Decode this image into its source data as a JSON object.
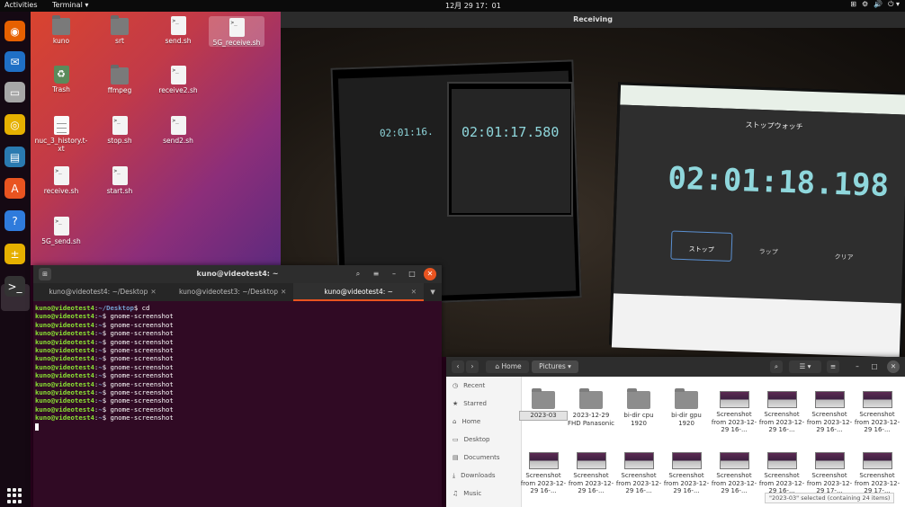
{
  "topbar": {
    "activities": "Activities",
    "app_menu": "Terminal ▾",
    "clock": "12月 29 17：01",
    "tray": [
      "⊞",
      "⚙",
      "🔊",
      "⏻ ▾"
    ]
  },
  "dock": {
    "items": [
      {
        "name": "firefox-icon",
        "glyph": "◉",
        "color": "#e66000"
      },
      {
        "name": "thunderbird-icon",
        "glyph": "✉",
        "color": "#1f6fc5"
      },
      {
        "name": "files-icon",
        "glyph": "▭",
        "color": "#a7a7a7"
      },
      {
        "name": "rhythmbox-icon",
        "glyph": "◎",
        "color": "#e6b000"
      },
      {
        "name": "writer-icon",
        "glyph": "▤",
        "color": "#2a7ab0"
      },
      {
        "name": "software-icon",
        "glyph": "A",
        "color": "#e95420"
      },
      {
        "name": "help-icon",
        "glyph": "?",
        "color": "#2f7bdc"
      },
      {
        "name": "calculator-icon",
        "glyph": "±",
        "color": "#e6b000"
      },
      {
        "name": "terminal-icon",
        "glyph": ">_",
        "color": "#333333"
      }
    ]
  },
  "desktop": {
    "icons": [
      {
        "label": "kuno",
        "kind": "home"
      },
      {
        "label": "srt",
        "kind": "folder"
      },
      {
        "label": "send.sh",
        "kind": "script"
      },
      {
        "label": "5G_receive.sh",
        "kind": "script"
      },
      {
        "label": "Trash",
        "kind": "trash"
      },
      {
        "label": "ffmpeg",
        "kind": "folder"
      },
      {
        "label": "receive2.sh",
        "kind": "script"
      },
      {
        "label": "nuc_3_history.t-xt",
        "kind": "doc"
      },
      {
        "label": "stop.sh",
        "kind": "script"
      },
      {
        "label": "send2.sh",
        "kind": "script"
      },
      {
        "label": "receive.sh",
        "kind": "script"
      },
      {
        "label": "start.sh",
        "kind": "script"
      },
      {
        "label": "5G_send.sh",
        "kind": "script"
      }
    ]
  },
  "receiving": {
    "title": "Receiving",
    "stopwatch_title": "ストップウォッチ",
    "time_big": "02:01:18.198",
    "time_mid": "02:01:17.580",
    "time_small": "02:01:16.",
    "stop": "ストップ",
    "lap": "ラップ",
    "clear": "クリア"
  },
  "terminal": {
    "title": "kuno@videotest4: ~",
    "tabs": [
      "kuno@videotest4: ~/Desktop",
      "kuno@videotest3: ~/Desktop",
      "kuno@videotest4: ~"
    ],
    "lines": [
      {
        "user": "kuno@videotest4",
        "path": "~/Desktop",
        "cmd": "$ cd"
      },
      {
        "user": "kuno@videotest4",
        "path": "~",
        "cmd": "$ gnome-screenshot"
      },
      {
        "user": "kuno@videotest4",
        "path": "~",
        "cmd": "$ gnome-screenshot"
      },
      {
        "user": "kuno@videotest4",
        "path": "~",
        "cmd": "$ gnome-screenshot"
      },
      {
        "user": "kuno@videotest4",
        "path": "~",
        "cmd": "$ gnome-screenshot"
      },
      {
        "user": "kuno@videotest4",
        "path": "~",
        "cmd": "$ gnome-screenshot"
      },
      {
        "user": "kuno@videotest4",
        "path": "~",
        "cmd": "$ gnome-screenshot"
      },
      {
        "user": "kuno@videotest4",
        "path": "~",
        "cmd": "$ gnome-screenshot"
      },
      {
        "user": "kuno@videotest4",
        "path": "~",
        "cmd": "$ gnome-screenshot"
      },
      {
        "user": "kuno@videotest4",
        "path": "~",
        "cmd": "$ gnome-screenshot"
      },
      {
        "user": "kuno@videotest4",
        "path": "~",
        "cmd": "$ gnome-screenshot"
      },
      {
        "user": "kuno@videotest4",
        "path": "~",
        "cmd": "$ gnome-screenshot"
      },
      {
        "user": "kuno@videotest4",
        "path": "~",
        "cmd": "$ gnome-screenshot"
      },
      {
        "user": "kuno@videotest4",
        "path": "~",
        "cmd": "$ gnome-screenshot"
      }
    ]
  },
  "files": {
    "path_home": "Home",
    "path_current": "Pictures",
    "sidebar": [
      {
        "icon": "◷",
        "label": "Recent"
      },
      {
        "icon": "★",
        "label": "Starred"
      },
      {
        "icon": "⌂",
        "label": "Home"
      },
      {
        "icon": "▭",
        "label": "Desktop"
      },
      {
        "icon": "▤",
        "label": "Documents"
      },
      {
        "icon": "⤓",
        "label": "Downloads"
      },
      {
        "icon": "♫",
        "label": "Music"
      }
    ],
    "row1": [
      {
        "label": "2023-03",
        "kind": "folder",
        "selected": true
      },
      {
        "label": "2023-12-29 FHD Panasonic",
        "kind": "folder"
      },
      {
        "label": "bi-dir cpu 1920",
        "kind": "folder"
      },
      {
        "label": "bi-dir gpu 1920",
        "kind": "folder"
      },
      {
        "label": "Screenshot from 2023-12-29 16-...",
        "kind": "shot"
      },
      {
        "label": "Screenshot from 2023-12-29 16-...",
        "kind": "shot"
      },
      {
        "label": "Screenshot from 2023-12-29 16-...",
        "kind": "shot"
      },
      {
        "label": "Screenshot from 2023-12-29 16-...",
        "kind": "shot"
      }
    ],
    "row2": [
      {
        "label": "Screenshot from 2023-12-29 16-...",
        "kind": "shot"
      },
      {
        "label": "Screenshot from 2023-12-29 16-...",
        "kind": "shot"
      },
      {
        "label": "Screenshot from 2023-12-29 16-...",
        "kind": "shot"
      },
      {
        "label": "Screenshot from 2023-12-29 16-...",
        "kind": "shot"
      },
      {
        "label": "Screenshot from 2023-12-29 16-...",
        "kind": "shot"
      },
      {
        "label": "Screenshot from 2023-12-29 16-...",
        "kind": "shot"
      },
      {
        "label": "Screenshot from 2023-12-29 17-...",
        "kind": "shot"
      },
      {
        "label": "Screenshot from 2023-12-29 17-...",
        "kind": "shot"
      }
    ],
    "status": "\"2023-03\" selected  (containing 24 items)"
  }
}
